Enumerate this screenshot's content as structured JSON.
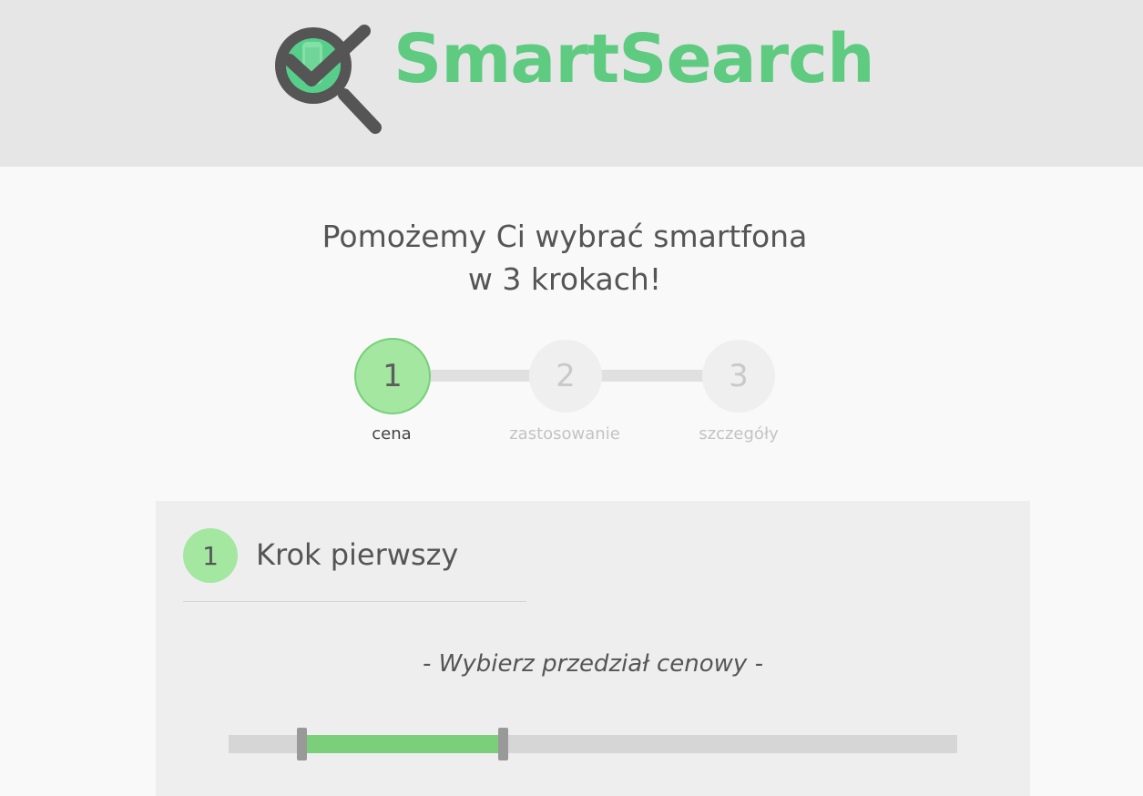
{
  "brand": {
    "name": "SmartSearch",
    "color": "#5ecb81"
  },
  "headline": {
    "line1": "Pomożemy Ci wybrać smartfona",
    "line2": "w 3 krokach!"
  },
  "steps": [
    {
      "number": "1",
      "label": "cena",
      "active": true
    },
    {
      "number": "2",
      "label": "zastosowanie",
      "active": false
    },
    {
      "number": "3",
      "label": "szczegóły",
      "active": false
    }
  ],
  "panel": {
    "badge": "1",
    "title": "Krok pierwszy",
    "prompt": "- Wybierz przedział cenowy -"
  },
  "price_slider": {
    "min_fraction": 0.1,
    "max_fraction": 0.377
  },
  "colors": {
    "accent_green": "#5ecb81",
    "active_step": "#a3e7a1",
    "range_fill": "#7bce7a"
  }
}
